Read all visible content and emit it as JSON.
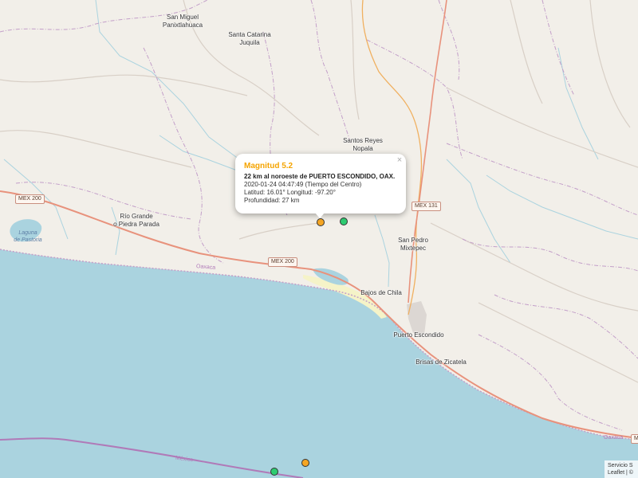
{
  "places": [
    {
      "id": "san-miguel",
      "lines": [
        "San Miguel",
        "Panixtlahuaca"
      ]
    },
    {
      "id": "santa-catarina",
      "lines": [
        "Santa Catarina",
        "Juquila"
      ]
    },
    {
      "id": "santos-reyes",
      "lines": [
        "Santos Reyes",
        "Nopala"
      ]
    },
    {
      "id": "rio-grande",
      "lines": [
        "Río Grande",
        "o Piedra Parada"
      ]
    },
    {
      "id": "san-pedro",
      "lines": [
        "San Pedro",
        "Mixtepec"
      ]
    },
    {
      "id": "bajos-de-chila",
      "lines": [
        "Bajos de Chila"
      ]
    },
    {
      "id": "puerto-escondido",
      "lines": [
        "Puerto Escondido"
      ]
    },
    {
      "id": "brisas-de-zicatela",
      "lines": [
        "Brisas de Zicatela"
      ]
    }
  ],
  "road_shields": [
    "MEX 200",
    "MEX 200",
    "MEX 131",
    "M"
  ],
  "water_labels": [
    {
      "lines": [
        "Laguna",
        "de Pastoria"
      ]
    }
  ],
  "boundary_labels": [
    "Oaxaca",
    "Oaxaca",
    "México"
  ],
  "markers": [
    {
      "id": "quake-selected",
      "color": "#f5a623",
      "magnitude": "5.2"
    },
    {
      "id": "quake-green-1",
      "color": "#2ecc71"
    },
    {
      "id": "quake-orange-2",
      "color": "#f5a623"
    },
    {
      "id": "quake-green-2",
      "color": "#2ecc71"
    }
  ],
  "popup": {
    "title": "Magnitud 5.2",
    "description": "22 km al noroeste de PUERTO ESCONDIDO, OAX.",
    "datetime": "2020-01-24  04:47:49 (Tiempo del Centro)",
    "coords": "Latitud: 16.01°  Longitud: -97.20°",
    "depth": "Profundidad: 27 km",
    "close": "×"
  },
  "attribution": {
    "line1": "Servicio S",
    "line2": "Leaflet | ©"
  },
  "colors": {
    "land": "#f2efe9",
    "water": "#aad3df",
    "road": "#e8927c",
    "state_boundary": "#b07ab8",
    "selected_marker": "#f5a623",
    "green_marker": "#2ecc71"
  }
}
